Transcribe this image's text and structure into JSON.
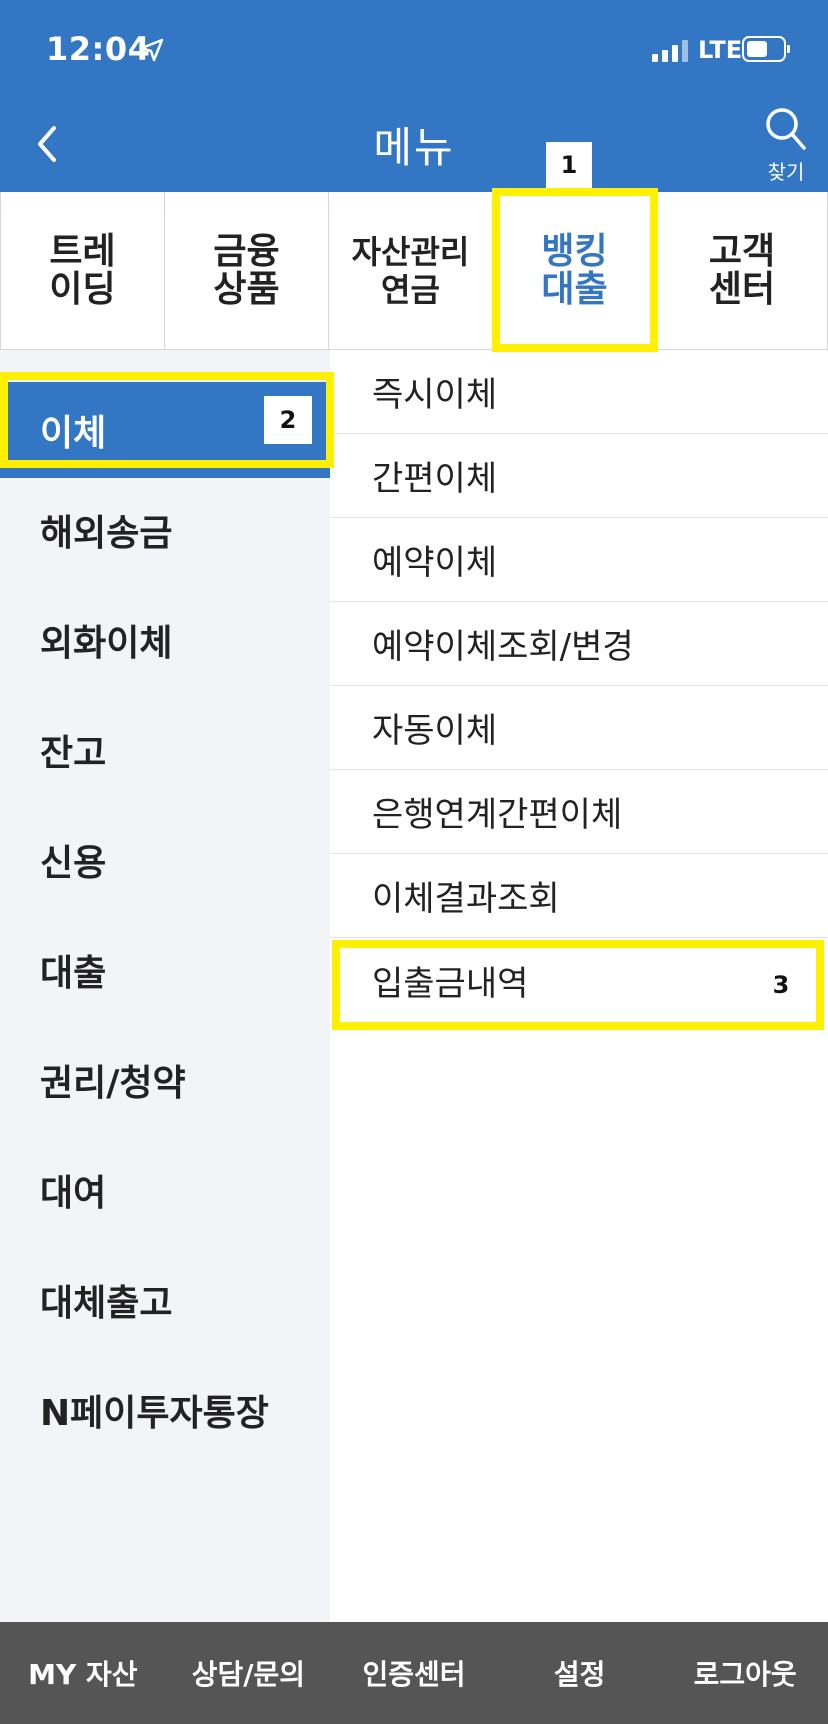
{
  "status_bar": {
    "time": "12:04",
    "network": "LTE"
  },
  "header": {
    "title": "메뉴",
    "search_label": "찾기"
  },
  "top_tabs": [
    {
      "label": "트레\n이딩"
    },
    {
      "label": "금융\n상품"
    },
    {
      "label": "자산관리\n연금"
    },
    {
      "label": "뱅킹\n대출"
    },
    {
      "label": "고객\n센터"
    }
  ],
  "categories": [
    {
      "label": "이체"
    },
    {
      "label": "해외송금"
    },
    {
      "label": "외화이체"
    },
    {
      "label": "잔고"
    },
    {
      "label": "신용"
    },
    {
      "label": "대출"
    },
    {
      "label": "권리/청약"
    },
    {
      "label": "대여"
    },
    {
      "label": "대체출고"
    },
    {
      "label": "N페이투자통장"
    }
  ],
  "submenu": [
    {
      "label": "즉시이체"
    },
    {
      "label": "간편이체"
    },
    {
      "label": "예약이체"
    },
    {
      "label": "예약이체조회/변경"
    },
    {
      "label": "자동이체"
    },
    {
      "label": "은행연계간편이체"
    },
    {
      "label": "이체결과조회"
    },
    {
      "label": "입출금내역"
    }
  ],
  "annotations": [
    {
      "number": "1"
    },
    {
      "number": "2"
    },
    {
      "number": "3"
    }
  ],
  "bottom_bar": [
    {
      "label": "MY 자산"
    },
    {
      "label": "상담/문의"
    },
    {
      "label": "인증센터"
    },
    {
      "label": "설정"
    },
    {
      "label": "로그아웃"
    }
  ],
  "colors": {
    "primary": "#3376c3",
    "highlight": "#ffef00",
    "sidebar_bg": "#f2f4f7",
    "bottom_bg": "#555555"
  }
}
